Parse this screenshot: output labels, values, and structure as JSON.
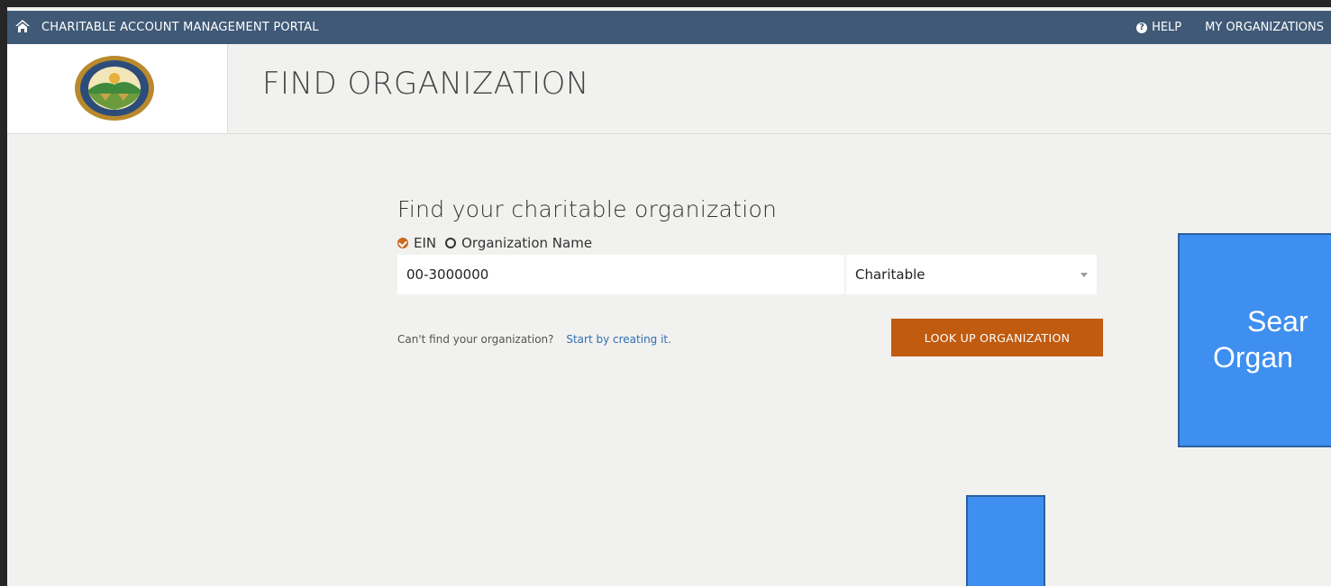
{
  "topbar": {
    "portal_title": "CHARITABLE ACCOUNT MANAGEMENT PORTAL",
    "help_label": "HELP",
    "my_orgs_label": "MY ORGANIZATIONS"
  },
  "header": {
    "page_title": "FIND ORGANIZATION"
  },
  "find_form": {
    "heading": "Find your charitable organization",
    "search_by_options": [
      {
        "label": "EIN",
        "selected": true
      },
      {
        "label": "Organization Name",
        "selected": false
      }
    ],
    "ein_value": "00-3000000",
    "org_type_selected": "Charitable",
    "lookup_button_label": "LOOK UP ORGANIZATION",
    "cant_find_text": "Can't find your organization?",
    "create_link_text": "Start by creating it."
  },
  "callout": {
    "line1": "Sear",
    "line2": "Organ",
    "color": "#3e8fef"
  },
  "colors": {
    "topbar": "#3f5976",
    "accent_button": "#c05b10",
    "link": "#2f6fb3"
  }
}
